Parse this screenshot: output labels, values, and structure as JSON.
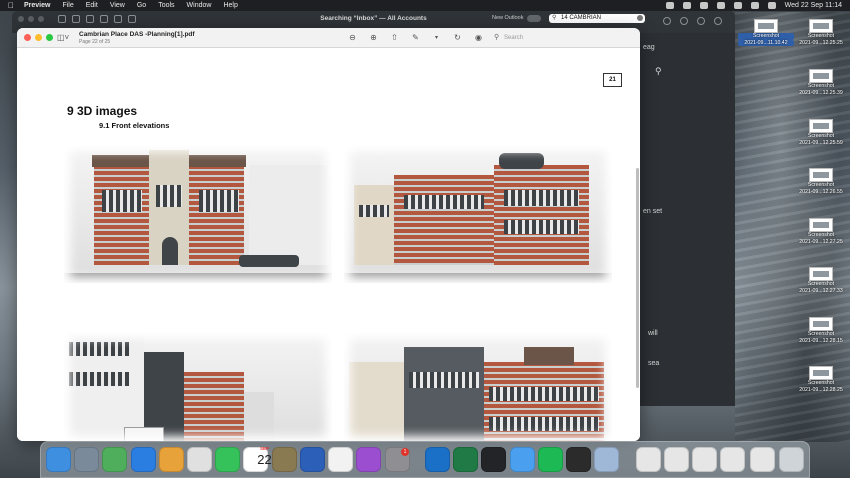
{
  "menubar": {
    "app": "Preview",
    "items": [
      "File",
      "Edit",
      "View",
      "Go",
      "Tools",
      "Window",
      "Help"
    ],
    "clock": "Wed 22 Sep  11:14"
  },
  "outlook": {
    "title": "Searching “Inbox” — All Accounts",
    "new_outlook": "New Outlook",
    "search_value": "14 CAMBRIAN",
    "snippets": [
      "eag",
      "en set",
      "will",
      "sea"
    ]
  },
  "preview": {
    "doc_title": "Cambrian Place DAS -Planning[1].pdf",
    "page_info": "Page 22 of 25",
    "search_placeholder": "Search",
    "page_number": "21",
    "heading": "9 3D images",
    "subheading": "9.1 Front elevations"
  },
  "desktop": {
    "screenshots": [
      {
        "line1": "Screenshot",
        "line2": "2021-09...11.10.42",
        "selected": true
      },
      {
        "line1": "Screenshot",
        "line2": "2021-09...12.25.25",
        "selected": false
      },
      {
        "line1": "Screenshot",
        "line2": "2021-09...12.25.39",
        "selected": false
      },
      {
        "line1": "Screenshot",
        "line2": "2021-09...12.25.59",
        "selected": false
      },
      {
        "line1": "Screenshot",
        "line2": "2021-09...12.26.55",
        "selected": false
      },
      {
        "line1": "Screenshot",
        "line2": "2021-09...12.27.25",
        "selected": false
      },
      {
        "line1": "Screenshot",
        "line2": "2021-09...12.27.33",
        "selected": false
      },
      {
        "line1": "Screenshot",
        "line2": "2021-09...12.28.15",
        "selected": false
      },
      {
        "line1": "Screenshot",
        "line2": "2021-09...12.28.25",
        "selected": false
      }
    ]
  },
  "dock": {
    "calendar_month": "SEP",
    "calendar_day": "22",
    "badge_count": "1",
    "apps": [
      {
        "name": "finder-icon",
        "color": "#3f8fe0"
      },
      {
        "name": "launchpad-icon",
        "color": "#7a8a9a"
      },
      {
        "name": "maps-icon",
        "color": "#4fae5c"
      },
      {
        "name": "safari-icon",
        "color": "#2a7de1"
      },
      {
        "name": "photos-icon",
        "color": "#e8a23a"
      },
      {
        "name": "chrome-icon",
        "color": "#e0e0e0"
      },
      {
        "name": "facetime-icon",
        "color": "#35c25a"
      },
      {
        "name": "calendar-icon",
        "color": "#ffffff"
      },
      {
        "name": "notes-icon",
        "color": "#8a7a52"
      },
      {
        "name": "word-icon",
        "color": "#2b5fb8"
      },
      {
        "name": "reminders-icon",
        "color": "#f2f2f2"
      },
      {
        "name": "podcasts-icon",
        "color": "#9b4fd0"
      },
      {
        "name": "system-preferences-icon",
        "color": "#8e8e93"
      },
      {
        "name": "outlook-icon",
        "color": "#1a6fc6"
      },
      {
        "name": "excel-icon",
        "color": "#1f7a45"
      },
      {
        "name": "stocks-icon",
        "color": "#222428"
      },
      {
        "name": "mail-icon",
        "color": "#4aa0ee"
      },
      {
        "name": "spotify-icon",
        "color": "#1db954"
      },
      {
        "name": "terminal-icon",
        "color": "#2b2b2b"
      },
      {
        "name": "preview-icon",
        "color": "#9fb8d8"
      },
      {
        "name": "recent-doc-1-icon",
        "color": "#e6e6e6"
      },
      {
        "name": "recent-doc-2-icon",
        "color": "#e6e6e6"
      },
      {
        "name": "recent-doc-3-icon",
        "color": "#e6e6e6"
      },
      {
        "name": "recent-doc-4-icon",
        "color": "#e6e6e6"
      },
      {
        "name": "recent-doc-5-icon",
        "color": "#e6e6e6"
      },
      {
        "name": "trash-icon",
        "color": "#cfd4d8"
      }
    ]
  }
}
